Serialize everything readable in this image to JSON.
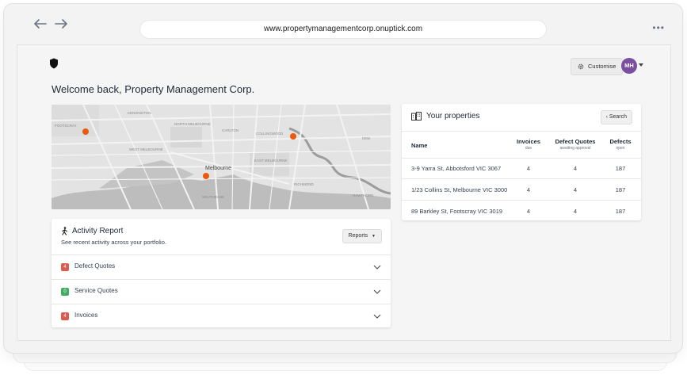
{
  "browser": {
    "url": "www.propertymanagementcorp.onuptick.com",
    "back_icon": "arrow-left-icon",
    "forward_icon": "arrow-right-icon",
    "more_icon": "more-dots-icon"
  },
  "header": {
    "welcome": "Welcome back, Property Management Corp.",
    "customise_label": "Customise",
    "avatar_initials": "MH",
    "avatar_color": "#7b4fa0"
  },
  "map": {
    "labels": [
      "KENSINGTON",
      "FOOTSCRAY",
      "NORTH MELBOURNE",
      "CARLTON",
      "COLLINGWOOD",
      "KEW",
      "WEST MELBOURNE",
      "Melbourne",
      "EAST MELBOURNE",
      "RICHMOND",
      "SOUTHBANK",
      "HAWTHORN"
    ],
    "marker_color": "#ea580c"
  },
  "activity": {
    "title": "Activity Report",
    "subtitle": "See recent activity across your portfolio.",
    "reports_label": "Reports",
    "items": [
      {
        "count": "4",
        "label": "Defect Quotes",
        "badge_color": "#dc5b4f"
      },
      {
        "count": "0",
        "label": "Service Quotes",
        "badge_color": "#3fae63"
      },
      {
        "count": "4",
        "label": "Invoices",
        "badge_color": "#dc5b4f"
      }
    ]
  },
  "properties": {
    "title": "Your properties",
    "search_label": "Search",
    "columns": {
      "name": "Name",
      "invoices": "Invoices",
      "invoices_sub": "due",
      "defect_quotes": "Defect Quotes",
      "defect_quotes_sub": "awaiting approval",
      "defects": "Defects",
      "defects_sub": "open"
    },
    "rows": [
      {
        "name": "3-9 Yarra St, Abbotsford VIC 3067",
        "invoices": "4",
        "defect_quotes": "4",
        "defects": "187"
      },
      {
        "name": "1/23 Collins St, Melbourne VIC 3000",
        "invoices": "4",
        "defect_quotes": "4",
        "defects": "187"
      },
      {
        "name": "89 Barkley St, Footscray VIC 3019",
        "invoices": "4",
        "defect_quotes": "4",
        "defects": "187"
      }
    ]
  }
}
